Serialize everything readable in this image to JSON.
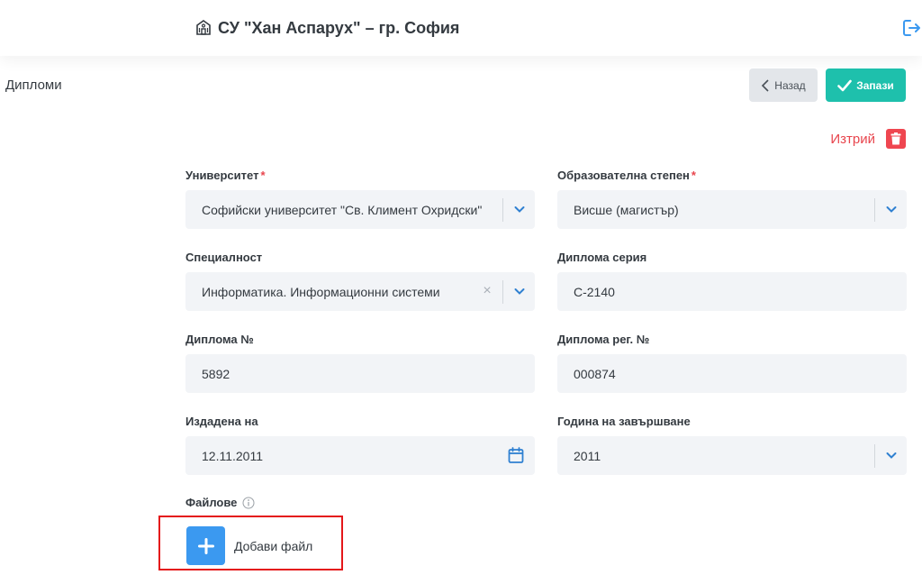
{
  "header": {
    "school_name": "СУ \"Хан Аспарух\" – гр. София",
    "school_icon": "school-building-icon",
    "logout_icon": "logout-icon"
  },
  "page": {
    "title": "Дипломи"
  },
  "toolbar": {
    "back_label": "Назад",
    "save_label": "Запази",
    "delete_label": "Изтрий"
  },
  "form": {
    "university": {
      "label": "Университет",
      "required": "*",
      "value": "Софийски университет \"Св. Климент Охридски\""
    },
    "degree": {
      "label": "Образователна степен",
      "required": "*",
      "value": "Висше (магистър)"
    },
    "specialty": {
      "label": "Специалност",
      "value": "Информатика. Информационни системи",
      "clear_glyph": "×"
    },
    "diploma_series": {
      "label": "Диплома серия",
      "value": "С-2140"
    },
    "diploma_number": {
      "label": "Диплома №",
      "value": "5892"
    },
    "diploma_reg_number": {
      "label": "Диплома рег. №",
      "value": "000874"
    },
    "issued_on": {
      "label": "Издадена на",
      "value": "12.11.2011"
    },
    "graduation_year": {
      "label": "Година на завършване",
      "value": "2011"
    }
  },
  "files": {
    "label": "Файлове",
    "add_label": "Добави файл"
  },
  "colors": {
    "accent_teal": "#1ec0ac",
    "danger_red": "#ef4650",
    "primary_blue": "#3b99f0",
    "highlight_red": "#e4171a"
  }
}
